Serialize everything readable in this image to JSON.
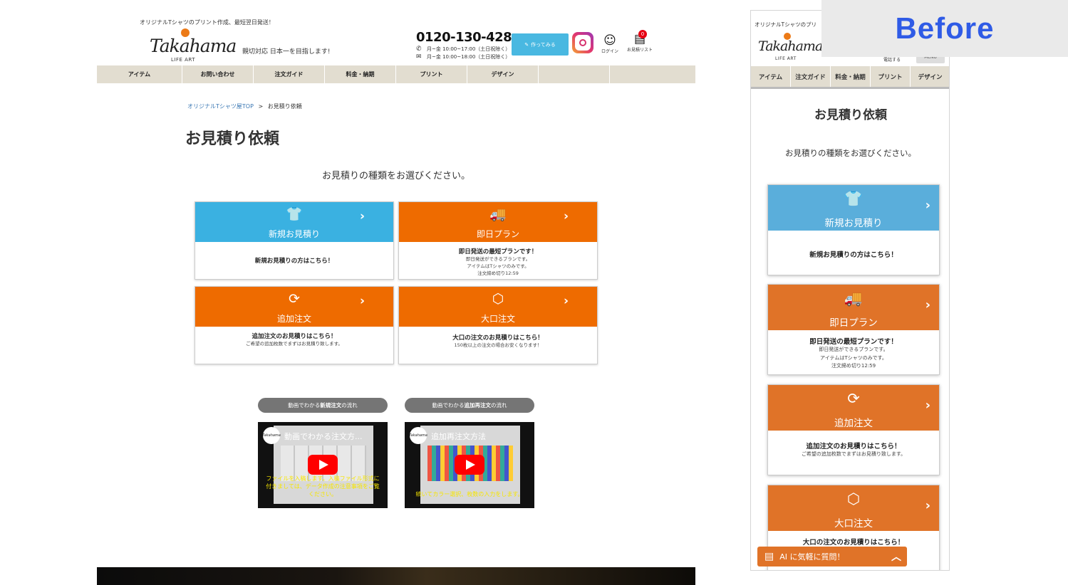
{
  "header": {
    "tagline": "オリジナルTシャツのプリント作成、最短翌日発送！",
    "logo_text": "Takahama",
    "logo_sub": "LIFE ART",
    "slogan": "親切対応 日本一を目指します!",
    "phone": "0120-130-428",
    "phone_hours": "月~金 10:00~17:00（土日祝除く）",
    "mail_hours": "月~金 10:00~18:00（土日祝除く）",
    "make_button": "作ってみる",
    "login_label": "ログイン",
    "quote_list_label": "お見積リスト",
    "cart_count": "0"
  },
  "nav": [
    "アイテム",
    "お問い合わせ",
    "注文ガイド",
    "料金・納期",
    "プリント",
    "デザイン",
    ""
  ],
  "breadcrumb": {
    "home": "オリジナルTシャツ屋TOP",
    "separator": ">",
    "current": "お見積り依頼"
  },
  "page": {
    "title": "お見積り依頼",
    "lead": "お見積りの種類をお選びください。"
  },
  "cards": [
    {
      "title": "新規お見積り",
      "icon": "tshirt-icon",
      "glyph": "👕",
      "main": "新規お見積りの方はこちら！",
      "sub": []
    },
    {
      "title": "即日プラン",
      "icon": "truck-icon",
      "glyph": "🚚",
      "main": "即日発送の最短プランです！",
      "sub": [
        "即日発送ができるプランです。",
        "アイテムはTシャツのみです。",
        "注文締め切り12:59"
      ]
    },
    {
      "title": "追加注文",
      "icon": "refresh-icon",
      "glyph": "⟳",
      "main": "追加注文のお見積りはこちら！",
      "sub": [
        "ご希望の追加枚数でまずはお見積り致します。"
      ]
    },
    {
      "title": "大口注文",
      "icon": "box-icon",
      "glyph": "⬡",
      "main": "大口の注文のお見積りはこちら！",
      "sub": [
        "150枚以上の注文の場合お安くなります！"
      ]
    }
  ],
  "videos": [
    {
      "pill_pre": "動画でわかる",
      "pill_bold": "新規注文",
      "pill_post": "の流れ",
      "title": "動画でわかる注文方...",
      "caption": "ファイルを入稿します。入稿ファイル形式に付きましては、データ作成の注意事項をご覧ください。"
    },
    {
      "pill_pre": "動画でわかる",
      "pill_bold": "追加再注文",
      "pill_post": "の流れ",
      "title": "追加再注文方法",
      "caption": "続いてカラー選択、枚数の入力をします。"
    }
  ],
  "mobile": {
    "tagline": "オリジナルTシャツのプリ",
    "call_label": "電話する",
    "menu_label": "MENU",
    "nav": [
      "アイテム",
      "注文ガイド",
      "料金・納期",
      "プリント",
      "デザイン"
    ],
    "title": "お見積り依頼",
    "lead": "お見積りの種類をお選びください。",
    "ai_label": "AI に気軽に質問！"
  },
  "overlay_label": "Before",
  "colors": {
    "blue": "#3ab1e1",
    "orange": "#ee6b00",
    "nav_bg": "#e2ddd0",
    "badge": "#e60012"
  }
}
